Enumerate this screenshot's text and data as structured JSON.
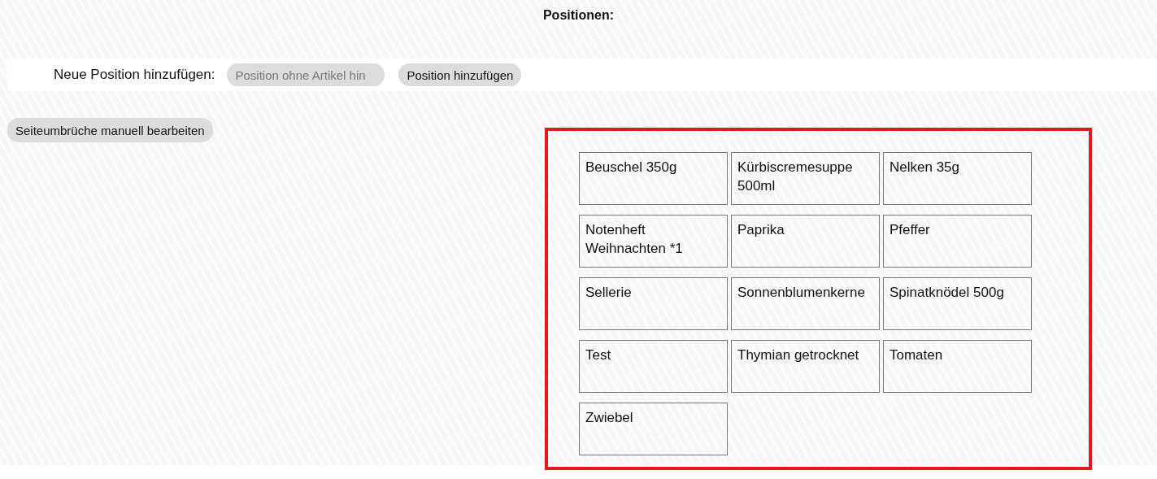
{
  "title": "Positionen:",
  "add_position": {
    "label": "Neue Position hinzufügen:",
    "input": {
      "placeholder": "Position ohne Artikel hin"
    },
    "button": "Position hinzufügen"
  },
  "page_break_button": "Seiteumbrüche manuell bearbeiten",
  "items": [
    "Beuschel 350g",
    "Kürbiscremesuppe 500ml",
    "Nelken 35g",
    "Notenheft Weihnachten *1",
    "Paprika",
    "Pfeffer",
    "Sellerie",
    "Sonnenblumenkerne",
    "Spinatknödel 500g",
    "Test",
    "Thymian getrocknet",
    "Tomaten",
    "Zwiebel"
  ]
}
